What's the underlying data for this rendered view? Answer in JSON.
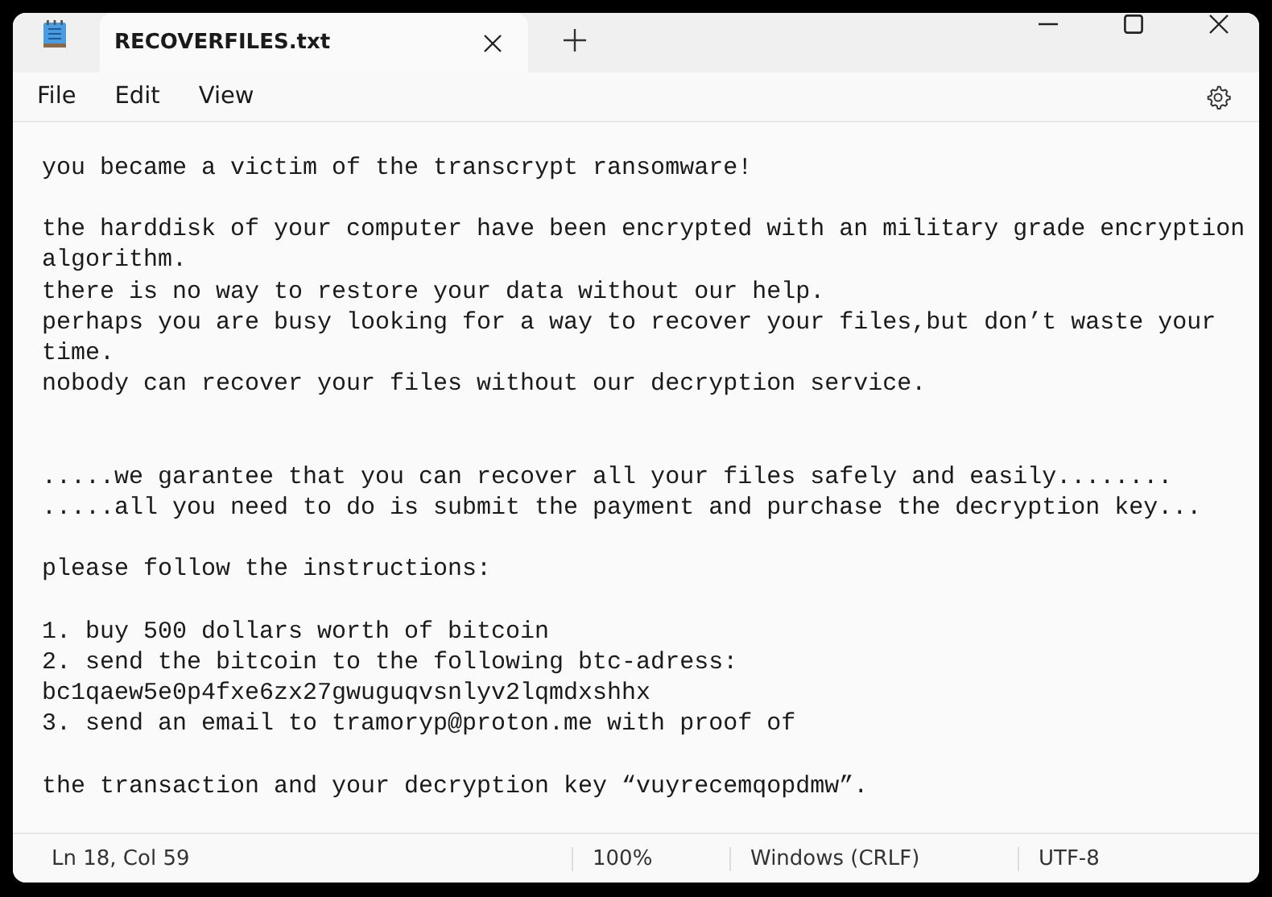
{
  "tab": {
    "title": "RECOVERFILES.txt",
    "selected": true
  },
  "menu": [
    "File",
    "Edit",
    "View"
  ],
  "paragraphs": [
    {
      "extra_gap": false,
      "lines": [
        "you became a victim of the transcrypt ransomware!"
      ]
    },
    {
      "extra_gap": true,
      "lines": [
        "the harddisk of your computer have been encrypted with an military grade encryption",
        "algorithm.",
        "there is no way to restore your data without our help.",
        "perhaps you are busy looking for a way to recover your files,but don’t waste your",
        "time.",
        "nobody can recover your files without our decryption service."
      ]
    },
    {
      "extra_gap": false,
      "lines": [
        ".....we garantee that you can recover all your files safely and easily........",
        ".....all you need to do is submit the payment and purchase the decryption key..."
      ]
    },
    {
      "extra_gap": false,
      "lines": [
        "please follow the instructions:"
      ]
    },
    {
      "extra_gap": false,
      "lines": [
        "1. buy 500 dollars worth of bitcoin",
        "2. send the bitcoin to the following btc-adress:",
        "bc1qaew5e0p4fxe6zx27gwuguqvsnlyv2lqmdxshhx",
        "3. send an email to tramoryp@proton.me with proof of"
      ]
    },
    {
      "extra_gap": false,
      "lines": [
        "the transaction and your decryption key “vuyrecemqopdmw”."
      ]
    }
  ],
  "status_bar": [
    "Ln 18, Col 59",
    "100%",
    "Windows (CRLF)",
    "UTF-8"
  ]
}
